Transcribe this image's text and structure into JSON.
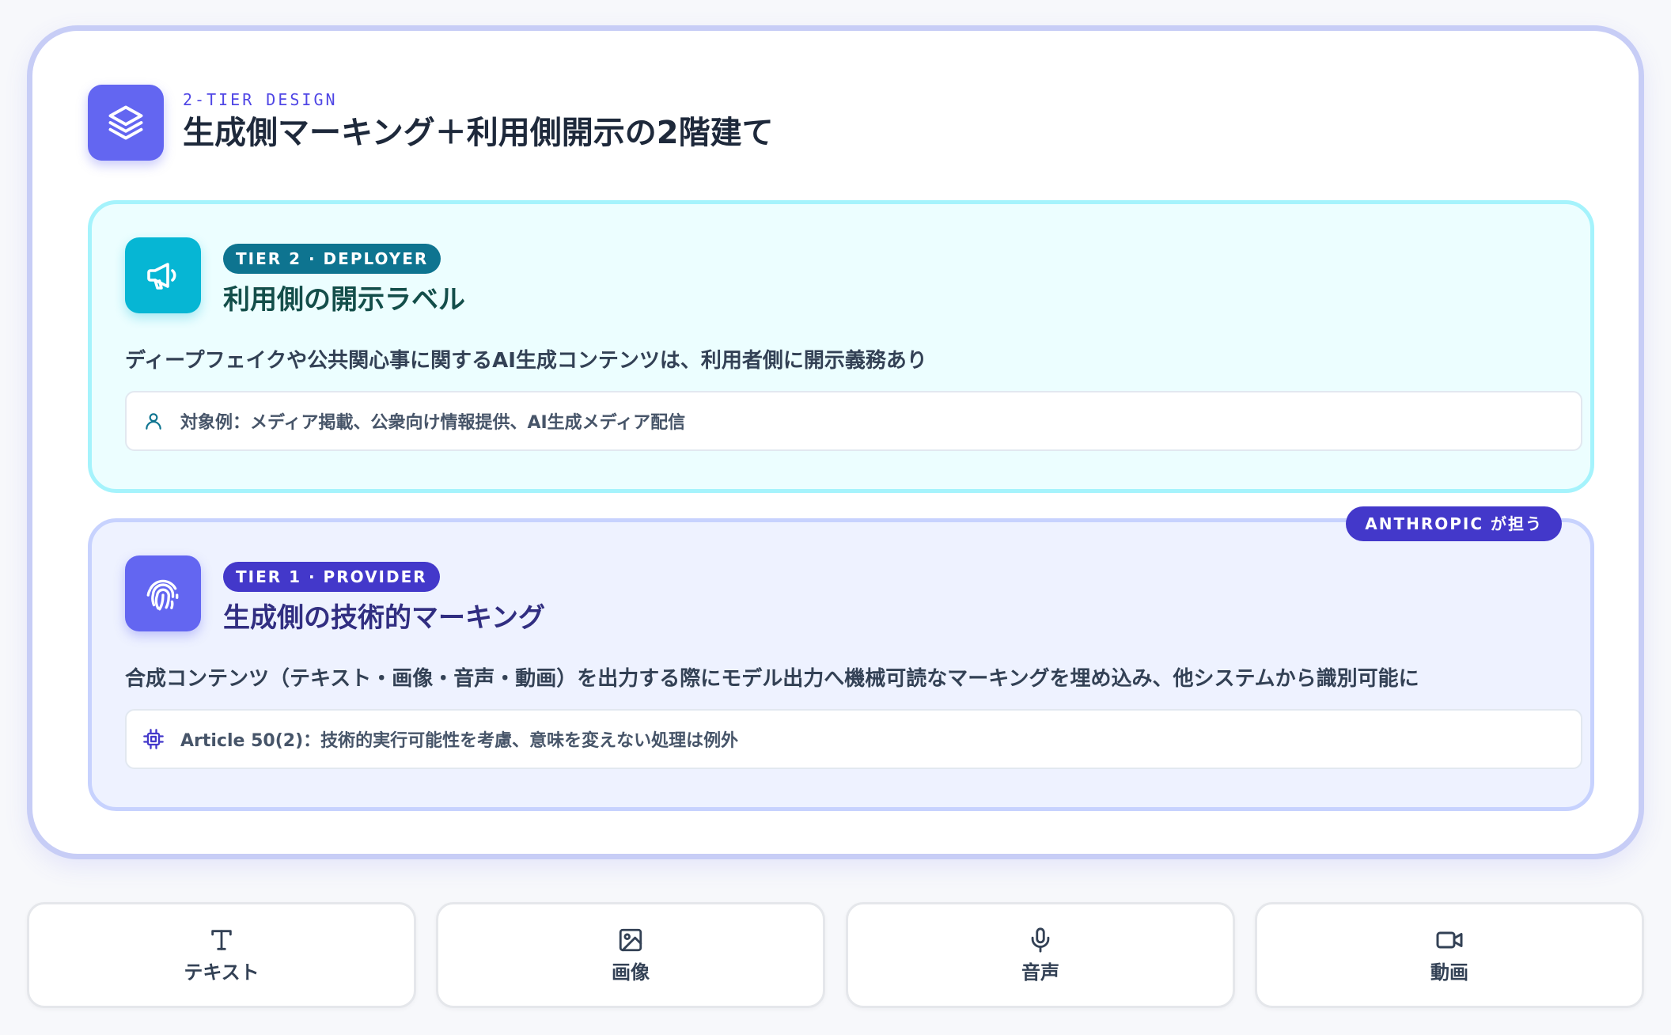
{
  "header": {
    "eyebrow": "2-TIER DESIGN",
    "title": "生成側マーキング＋利用側開示の2階建て",
    "icon": "layers-icon"
  },
  "tier2": {
    "badge": "TIER 2 · DEPLOYER",
    "title": "利用側の開示ラベル",
    "description": "ディープフェイクや公共関心事に関するAI生成コンテンツは、利用者側に開示義務あり",
    "note": "対象例：メディア掲載、公衆向け情報提供、AI生成メディア配信",
    "icon": "megaphone-icon",
    "note_icon": "user-icon",
    "accent": "#06b6d4"
  },
  "tier1": {
    "badge": "TIER 1 · PROVIDER",
    "title": "生成側の技術的マーキング",
    "description": "合成コンテンツ（テキスト・画像・音声・動画）を出力する際にモデル出力へ機械可読なマーキングを埋め込み、他システムから識別可能に",
    "note": "Article 50(2)：技術的実行可能性を考慮、意味を変えない処理は例外",
    "icon": "fingerprint-icon",
    "note_icon": "chip-icon",
    "owner_badge": "ANTHROPIC が担う",
    "accent": "#6366f1"
  },
  "media": [
    {
      "label": "テキスト",
      "icon": "text-icon"
    },
    {
      "label": "画像",
      "icon": "image-icon"
    },
    {
      "label": "音声",
      "icon": "microphone-icon"
    },
    {
      "label": "動画",
      "icon": "video-icon"
    }
  ]
}
